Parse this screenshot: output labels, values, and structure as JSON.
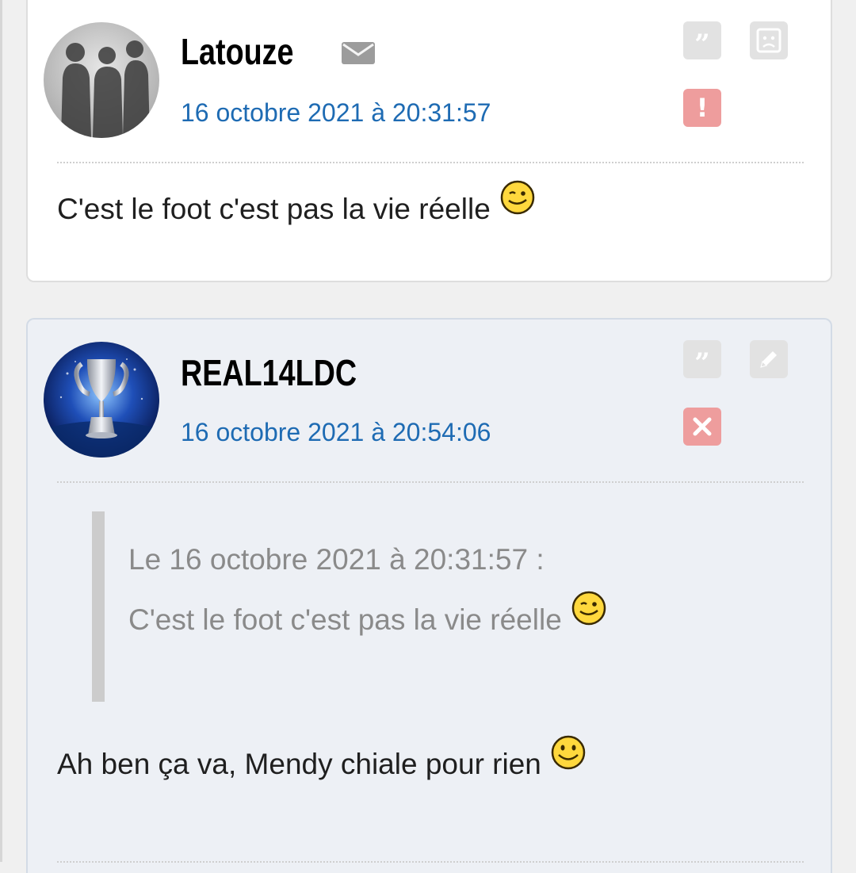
{
  "posts": [
    {
      "username": "Latouze",
      "date": "16 octobre 2021 à 20:31:57",
      "message": "C'est le foot c'est pas la vie réelle",
      "message_icon": "wink-smiley-icon",
      "actions": [
        "quote-icon",
        "sad-face-icon",
        "alert-exclamation-icon"
      ],
      "header_icon": "envelope-icon"
    },
    {
      "username": "REAL14LDC",
      "date": "16 octobre 2021 à 20:54:06",
      "quote": {
        "header": "Le 16 octobre 2021 à 20:31:57 :",
        "text": "C'est le foot c'est pas la vie réelle",
        "icon": "wink-smiley-icon"
      },
      "message": "Ah ben ça va, Mendy chiale pour rien",
      "message_icon": "smile-smiley-icon",
      "actions": [
        "quote-icon",
        "edit-pencil-icon",
        "delete-x-icon"
      ]
    }
  ],
  "colors": {
    "date_link": "#1e6bb3",
    "alert_button": "#ee9d9d",
    "own_post_background": "#edf0f5"
  }
}
